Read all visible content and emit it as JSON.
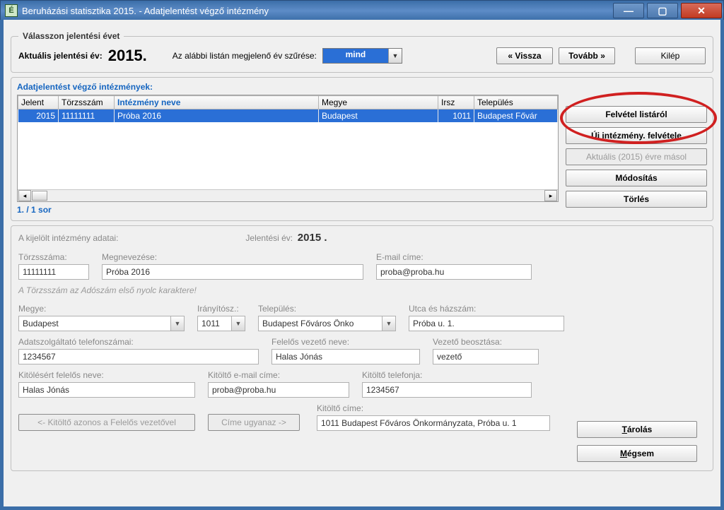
{
  "window": {
    "title": "Beruházási statisztika 2015. - Adatjelentést végző intézmény",
    "icon_letter": "É"
  },
  "year_group": {
    "legend": "Válasszon jelentési évet",
    "current_label": "Aktuális jelentési év:",
    "current_year": "2015.",
    "filter_label": "Az alábbi listán megjelenő év szűrése:",
    "filter_value": "mind",
    "back": "« Vissza",
    "next": "Tovább »",
    "exit": "Kilép"
  },
  "list_panel": {
    "title": "Adatjelentést végző intézmények:",
    "columns": [
      "Jelent",
      "Törzsszám",
      "Intézmény neve",
      "Megye",
      "Irsz",
      "Település"
    ],
    "rows": [
      {
        "jelent": "2015",
        "torzs": "11111111",
        "nev": "Próba 2016",
        "megye": "Budapest",
        "irsz": "1011",
        "telep": "Budapest Fővár"
      }
    ],
    "row_count": "1. / 1 sor",
    "buttons": {
      "from_list": "Felvétel listáról",
      "new": "Új intézmény. felvétele",
      "copy_year": "Aktuális (2015) évre másol",
      "modify": "Módosítás",
      "delete": "Törlés"
    }
  },
  "detail": {
    "header": "A kijelölt intézmény adatai:",
    "year_label": "Jelentési év:",
    "year_value": "2015 .",
    "labels": {
      "torzs": "Törzsszáma:",
      "megnev": "Megnevezése:",
      "email": "E-mail címe:",
      "megye": "Megye:",
      "iranyito": "Irányítósz.:",
      "telepules": "Település:",
      "utca": "Utca és házszám:",
      "adatszolg_tel": "Adatszolgáltató telefonszámai:",
      "vezeto_nev": "Felelős vezető neve:",
      "vezeto_beoszt": "Vezető beosztása:",
      "kitolto_nev": "Kitölésért felelős neve:",
      "kitolto_email": "Kitöltő e-mail címe:",
      "kitolto_tel": "Kitöltő telefonja:",
      "kitolto_cim": "Kitöltő címe:"
    },
    "values": {
      "torzs": "11111111",
      "megnev": "Próba 2016",
      "email": "proba@proba.hu",
      "megye": "Budapest",
      "iranyito": "1011",
      "telepules": "Budapest Főváros Önko",
      "utca": "Próba u. 1.",
      "adatszolg_tel": "1234567",
      "vezeto_nev": "Halas Jónás",
      "vezeto_beoszt": "vezető",
      "kitolto_nev": "Halas Jónás",
      "kitolto_email": "proba@proba.hu",
      "kitolto_tel": "1234567",
      "kitolto_cim": "1011 Budapest Főváros Önkormányzata, Próba u. 1"
    },
    "note": "A Törzsszám az Adószám első nyolc karaktere!",
    "buttons": {
      "copy_vezeto": "<- Kitöltő azonos a Felelős vezetővel",
      "copy_cim": "Címe ugyanaz ->",
      "save_pre": "T",
      "save_post": "árolás",
      "cancel_pre": "M",
      "cancel_post": "égsem"
    }
  }
}
